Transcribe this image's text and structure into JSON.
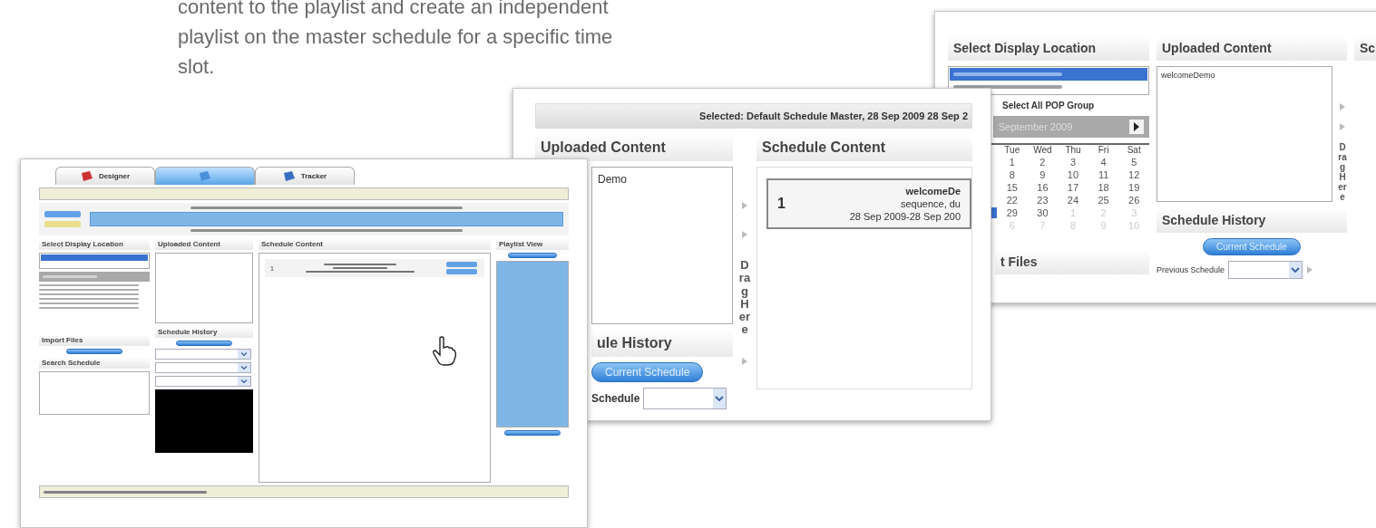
{
  "intro_text": [
    "content to the playlist and create an independent",
    "playlist on the master schedule for a specific time",
    "slot."
  ],
  "screenshot_right": {
    "location_heading": "Select Display Location",
    "locations": [
      {
        "selected": true
      },
      {
        "selected": false
      }
    ],
    "group_label": "Select All POP Group",
    "month": "September 2009",
    "weekdays": [
      "Tue",
      "Wed",
      "Thu",
      "Fri",
      "Sat"
    ],
    "weeks": [
      {
        "selected": false,
        "days": [
          {
            "label": "1",
            "muted": false
          },
          {
            "label": "2",
            "muted": false
          },
          {
            "label": "3",
            "muted": false
          },
          {
            "label": "4",
            "muted": false
          },
          {
            "label": "5",
            "muted": false
          }
        ]
      },
      {
        "selected": false,
        "days": [
          {
            "label": "8",
            "muted": false
          },
          {
            "label": "9",
            "muted": false
          },
          {
            "label": "10",
            "muted": false
          },
          {
            "label": "11",
            "muted": false
          },
          {
            "label": "12",
            "muted": false
          }
        ]
      },
      {
        "selected": false,
        "days": [
          {
            "label": "15",
            "muted": false
          },
          {
            "label": "16",
            "muted": false
          },
          {
            "label": "17",
            "muted": false
          },
          {
            "label": "18",
            "muted": false
          },
          {
            "label": "19",
            "muted": false
          }
        ]
      },
      {
        "selected": false,
        "days": [
          {
            "label": "22",
            "muted": false
          },
          {
            "label": "23",
            "muted": false
          },
          {
            "label": "24",
            "muted": false
          },
          {
            "label": "25",
            "muted": false
          },
          {
            "label": "26",
            "muted": false
          }
        ]
      },
      {
        "selected": true,
        "days": [
          {
            "label": "29",
            "muted": false
          },
          {
            "label": "30",
            "muted": false
          },
          {
            "label": "1",
            "muted": true
          },
          {
            "label": "2",
            "muted": true
          },
          {
            "label": "3",
            "muted": true
          }
        ]
      },
      {
        "selected": false,
        "days": [
          {
            "label": "6",
            "muted": true
          },
          {
            "label": "7",
            "muted": true
          },
          {
            "label": "8",
            "muted": true
          },
          {
            "label": "9",
            "muted": true
          },
          {
            "label": "10",
            "muted": true
          }
        ]
      }
    ],
    "files_heading": "t Files",
    "uploaded_heading": "Uploaded Content",
    "uploaded_item": "welcomeDemo",
    "history_heading": "Schedule History",
    "current_button": "Current Schedule",
    "previous_label": "Previous Schedule",
    "drag_label": "Drag Here",
    "schedule_heading": "Sc"
  },
  "screenshot_middle": {
    "selected_bar": "Selected: Default Schedule Master, 28 Sep 2009 28 Sep 2",
    "uploaded_heading": "Uploaded Content",
    "uploaded_item": "Demo",
    "history_heading": "ule History",
    "current_button": "Current Schedule",
    "schedule_label": "Schedule",
    "drag_label": "Drag Here",
    "schedule_heading": "Schedule Content",
    "entry": {
      "index": "1",
      "title": "welcomeDe",
      "line_1": "sequence, du",
      "line_2": "28 Sep 2009-28 Sep 200"
    }
  },
  "screenshot_front": {
    "tabs": [
      {
        "label": "Designer",
        "selected": false
      },
      {
        "selected": true
      },
      {
        "label": "Tracker",
        "selected": false
      }
    ],
    "headings": {
      "location": "Select Display Location",
      "uploaded": "Uploaded Content",
      "schedule": "Schedule Content",
      "playlist": "Playlist View",
      "history": "Schedule History",
      "import": "Import Files",
      "search": "Search Schedule"
    },
    "entry": {
      "index": "1"
    }
  }
}
